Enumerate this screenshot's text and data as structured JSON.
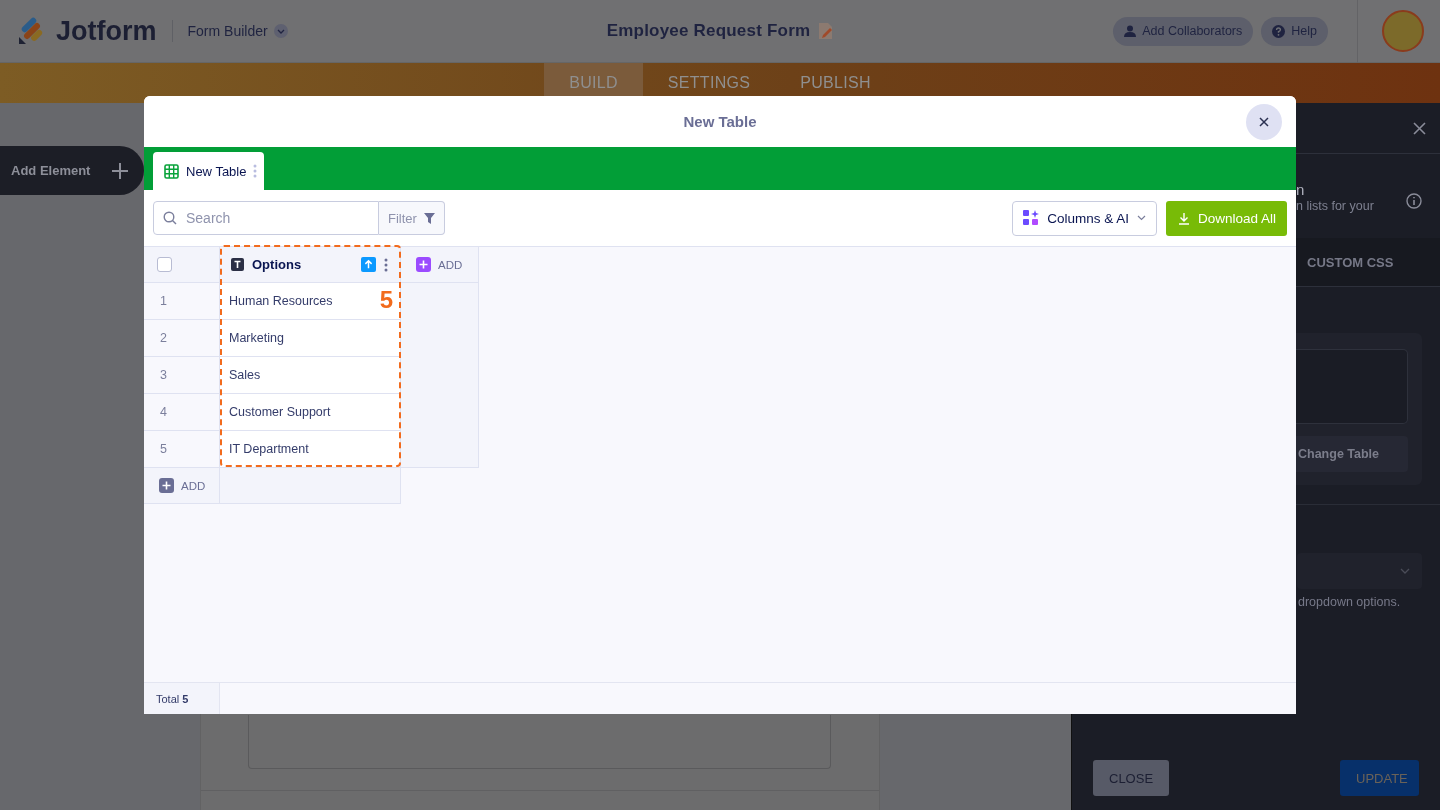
{
  "header": {
    "logo": "Jotform",
    "builder_menu": "Form Builder",
    "form_title": "Employee Request Form",
    "buttons": [
      {
        "label": "Add Collaborators",
        "kind": "user"
      },
      {
        "label": "Help",
        "kind": "help"
      }
    ]
  },
  "nav_tabs": [
    {
      "label": "BUILD",
      "selected": true
    },
    {
      "label": "SETTINGS",
      "selected": false
    },
    {
      "label": "PUBLISH",
      "selected": false
    }
  ],
  "add_element": "Add Element",
  "side_panel": {
    "title": "n",
    "description": "n lists for your",
    "tab": "CUSTOM CSS",
    "change_table": "Change Table",
    "hint": "dropdown options.",
    "buttons": [
      {
        "label": "CLOSE",
        "kind": "secondary"
      },
      {
        "label": "UPDATE",
        "kind": "primary"
      }
    ]
  },
  "modal": {
    "title": "New Table",
    "sheet_tabs": [
      {
        "label": "New Table",
        "selected": true
      }
    ],
    "search": {
      "placeholder": "Search"
    },
    "filter": "Filter",
    "columns_menu": "Columns & AI",
    "download": "Download All",
    "table": {
      "select_all": {
        "checked": false
      },
      "columns": [
        {
          "label": "Options"
        }
      ],
      "add_column": "ADD",
      "rows": [
        {
          "number": "1",
          "cells": [
            "Human Resources"
          ]
        },
        {
          "number": "2",
          "cells": [
            "Marketing"
          ]
        },
        {
          "number": "3",
          "cells": [
            "Sales"
          ]
        },
        {
          "number": "4",
          "cells": [
            "Customer Support"
          ]
        },
        {
          "number": "5",
          "cells": [
            "IT Department"
          ]
        }
      ],
      "add_row": "ADD"
    },
    "annotation": "5",
    "footer": "Total **5**"
  }
}
